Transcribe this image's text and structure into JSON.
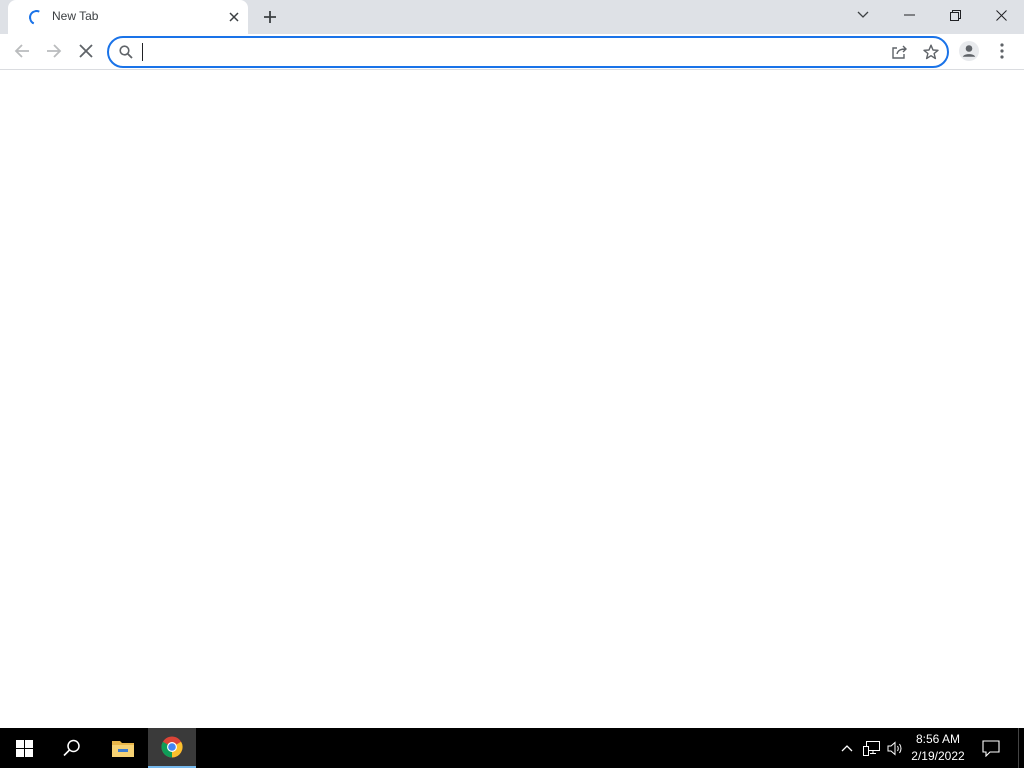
{
  "browser": {
    "tab": {
      "title": "New Tab",
      "status_icon": "loading-spinner-icon",
      "close_icon": "close-icon"
    },
    "new_tab_icon": "plus-icon",
    "window_controls": {
      "tab_search_icon": "chevron-down-icon",
      "minimize_icon": "minimize-icon",
      "maximize_icon": "restore-icon",
      "close_icon": "close-icon"
    },
    "toolbar": {
      "back_icon": "arrow-left-icon",
      "forward_icon": "arrow-right-icon",
      "stop_icon": "close-icon",
      "omnibox": {
        "value": "",
        "placeholder": "",
        "search_icon": "search-icon",
        "share_icon": "share-icon",
        "bookmark_icon": "star-icon"
      },
      "profile_icon": "avatar-icon",
      "menu_icon": "kebab-menu-icon"
    },
    "accent_color": "#1a73e8"
  },
  "taskbar": {
    "start_icon": "windows-logo-icon",
    "search_icon": "search-icon",
    "apps": [
      {
        "name": "File Explorer",
        "icon": "folder-icon",
        "active": false
      },
      {
        "name": "Google Chrome",
        "icon": "chrome-icon",
        "active": true
      }
    ],
    "tray": {
      "chevron_icon": "chevron-up-icon",
      "network_icon": "network-icon",
      "volume_icon": "speaker-icon"
    },
    "clock": {
      "time": "8:56 AM",
      "date": "2/19/2022"
    },
    "notifications_icon": "action-center-icon"
  }
}
